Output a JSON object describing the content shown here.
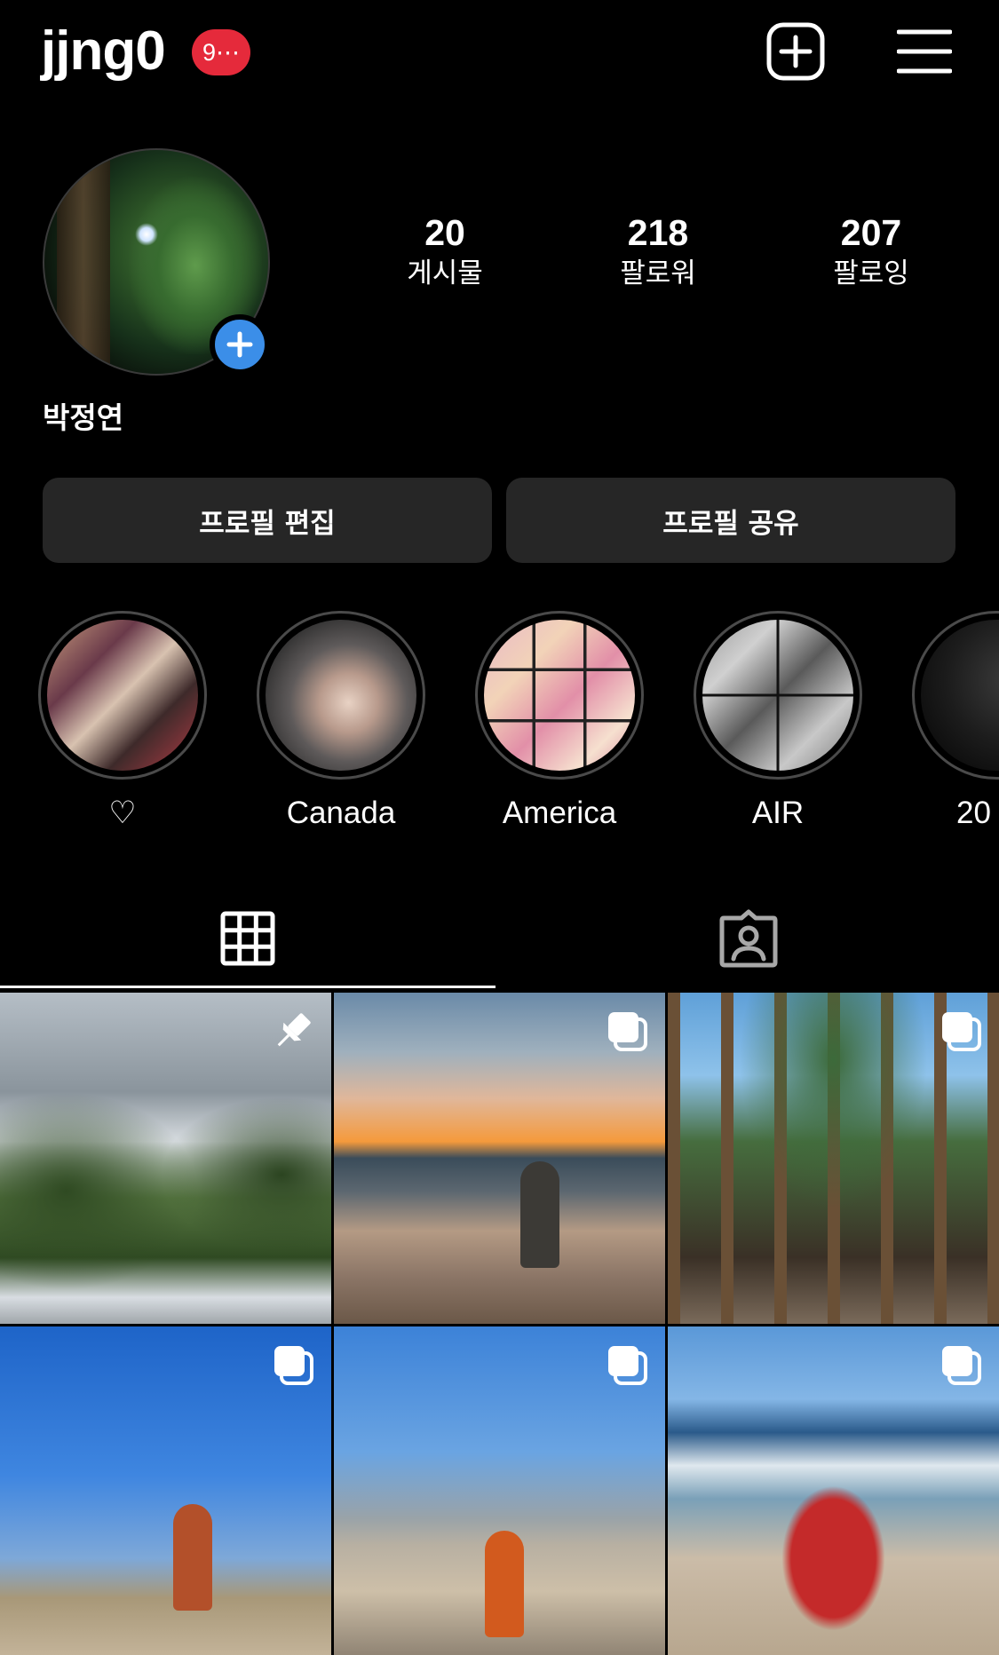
{
  "header": {
    "username": "jjng0",
    "notification_badge": "9⋯"
  },
  "profile": {
    "display_name": "박정연",
    "stats": [
      {
        "value": "20",
        "label": "게시물"
      },
      {
        "value": "218",
        "label": "팔로워"
      },
      {
        "value": "207",
        "label": "팔로잉"
      }
    ],
    "buttons": {
      "edit": "프로필 편집",
      "share": "프로필 공유"
    }
  },
  "highlights": [
    {
      "label": "♡"
    },
    {
      "label": "Canada"
    },
    {
      "label": "America"
    },
    {
      "label": "AIR"
    },
    {
      "label": "20"
    }
  ],
  "tabs": [
    {
      "icon": "grid-icon",
      "active": true
    },
    {
      "icon": "tagged-person-icon",
      "active": false
    }
  ],
  "posts": [
    {
      "overlay_icon": "pin-icon"
    },
    {
      "overlay_icon": "multiple-photos-icon"
    },
    {
      "overlay_icon": "multiple-photos-icon"
    },
    {
      "overlay_icon": "multiple-photos-icon"
    },
    {
      "overlay_icon": "multiple-photos-icon"
    },
    {
      "overlay_icon": "multiple-photos-icon"
    }
  ],
  "colors": {
    "background": "#000000",
    "badge": "#e52a3b",
    "accent_blue": "#3b8ee8",
    "button_bg": "#262626"
  }
}
